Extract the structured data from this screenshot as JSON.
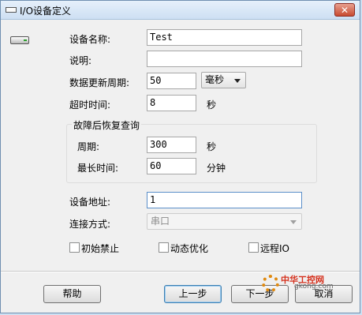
{
  "window": {
    "title": "I/O设备定义",
    "close_glyph": "✕"
  },
  "form": {
    "device_name": {
      "label": "设备名称:",
      "value": "Test"
    },
    "description": {
      "label": "说明:",
      "value": ""
    },
    "update_period": {
      "label": "数据更新周期:",
      "value": "50",
      "unit_selected": "毫秒"
    },
    "timeout": {
      "label": "超时时间:",
      "value": "8",
      "unit": "秒"
    },
    "recovery_group": {
      "title": "故障后恢复查询",
      "period": {
        "label": "周期:",
        "value": "300",
        "unit": "秒"
      },
      "max_time": {
        "label": "最长时间:",
        "value": "60",
        "unit": "分钟"
      }
    },
    "device_address": {
      "label": "设备地址:",
      "value": "1"
    },
    "connection_mode": {
      "label": "连接方式:",
      "value": "串口"
    },
    "checkboxes": [
      {
        "label": "初始禁止",
        "checked": false
      },
      {
        "label": "动态优化",
        "checked": false
      },
      {
        "label": "远程IO",
        "checked": false
      }
    ]
  },
  "buttons": {
    "help": "帮助",
    "prev": "上一步",
    "next": "下一步",
    "cancel": "取消"
  },
  "watermark": {
    "text": "中华工控网",
    "sub": "gkong.com"
  }
}
